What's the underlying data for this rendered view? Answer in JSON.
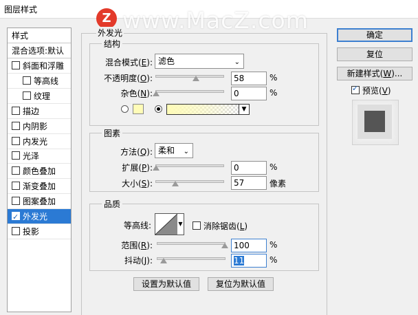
{
  "window": {
    "title": "图层样式"
  },
  "watermark": {
    "logo": "Z",
    "text": "www.MacZ.com"
  },
  "left_panel": {
    "header": "样式",
    "blend_options": "混合选项:默认",
    "items": [
      {
        "label": "斜面和浮雕",
        "checked": false,
        "indent": false
      },
      {
        "label": "等高线",
        "checked": false,
        "indent": true
      },
      {
        "label": "纹理",
        "checked": false,
        "indent": true
      },
      {
        "label": "描边",
        "checked": false,
        "indent": false
      },
      {
        "label": "内阴影",
        "checked": false,
        "indent": false
      },
      {
        "label": "内发光",
        "checked": false,
        "indent": false
      },
      {
        "label": "光泽",
        "checked": false,
        "indent": false
      },
      {
        "label": "颜色叠加",
        "checked": false,
        "indent": false
      },
      {
        "label": "渐变叠加",
        "checked": false,
        "indent": false
      },
      {
        "label": "图案叠加",
        "checked": false,
        "indent": false
      },
      {
        "label": "外发光",
        "checked": true,
        "indent": false,
        "selected": true
      },
      {
        "label": "投影",
        "checked": false,
        "indent": false
      }
    ]
  },
  "outer_glow": {
    "title": "外发光",
    "structure": {
      "title": "结构",
      "blend_mode_label": "混合模式(",
      "blend_mode_key": "E",
      "blend_mode_value": "滤色",
      "opacity_label": "不透明度(",
      "opacity_key": "O",
      "opacity_value": "58",
      "noise_label": "杂色(",
      "noise_key": "N",
      "noise_value": "0",
      "percent": "%",
      "glow_color": "#fffcb8"
    },
    "elements": {
      "title": "图素",
      "method_label": "方法(",
      "method_key": "Q",
      "method_value": "柔和",
      "spread_label": "扩展(",
      "spread_key": "P",
      "spread_value": "0",
      "size_label": "大小(",
      "size_key": "S",
      "size_value": "57",
      "size_unit": "像素",
      "percent": "%"
    },
    "quality": {
      "title": "品质",
      "contour_label": "等高线:",
      "antialias_label": "消除锯齿(",
      "antialias_key": "L",
      "antialias_checked": false,
      "range_label": "范围(",
      "range_key": "R",
      "range_value": "100",
      "jitter_label": "抖动(",
      "jitter_key": "J",
      "jitter_value": "11",
      "percent": "%"
    },
    "set_default": "设置为默认值",
    "reset_default": "复位为默认值"
  },
  "right_panel": {
    "ok": "确定",
    "reset": "复位",
    "new_style": "新建样式(",
    "new_style_key": "W",
    "new_style_suffix": ")...",
    "preview_label": "预览(",
    "preview_key": "V",
    "preview_checked": true
  },
  "colors": {
    "selection": "#2b7ad4",
    "glow": "#fffcb8",
    "preview_square": "#555555"
  }
}
